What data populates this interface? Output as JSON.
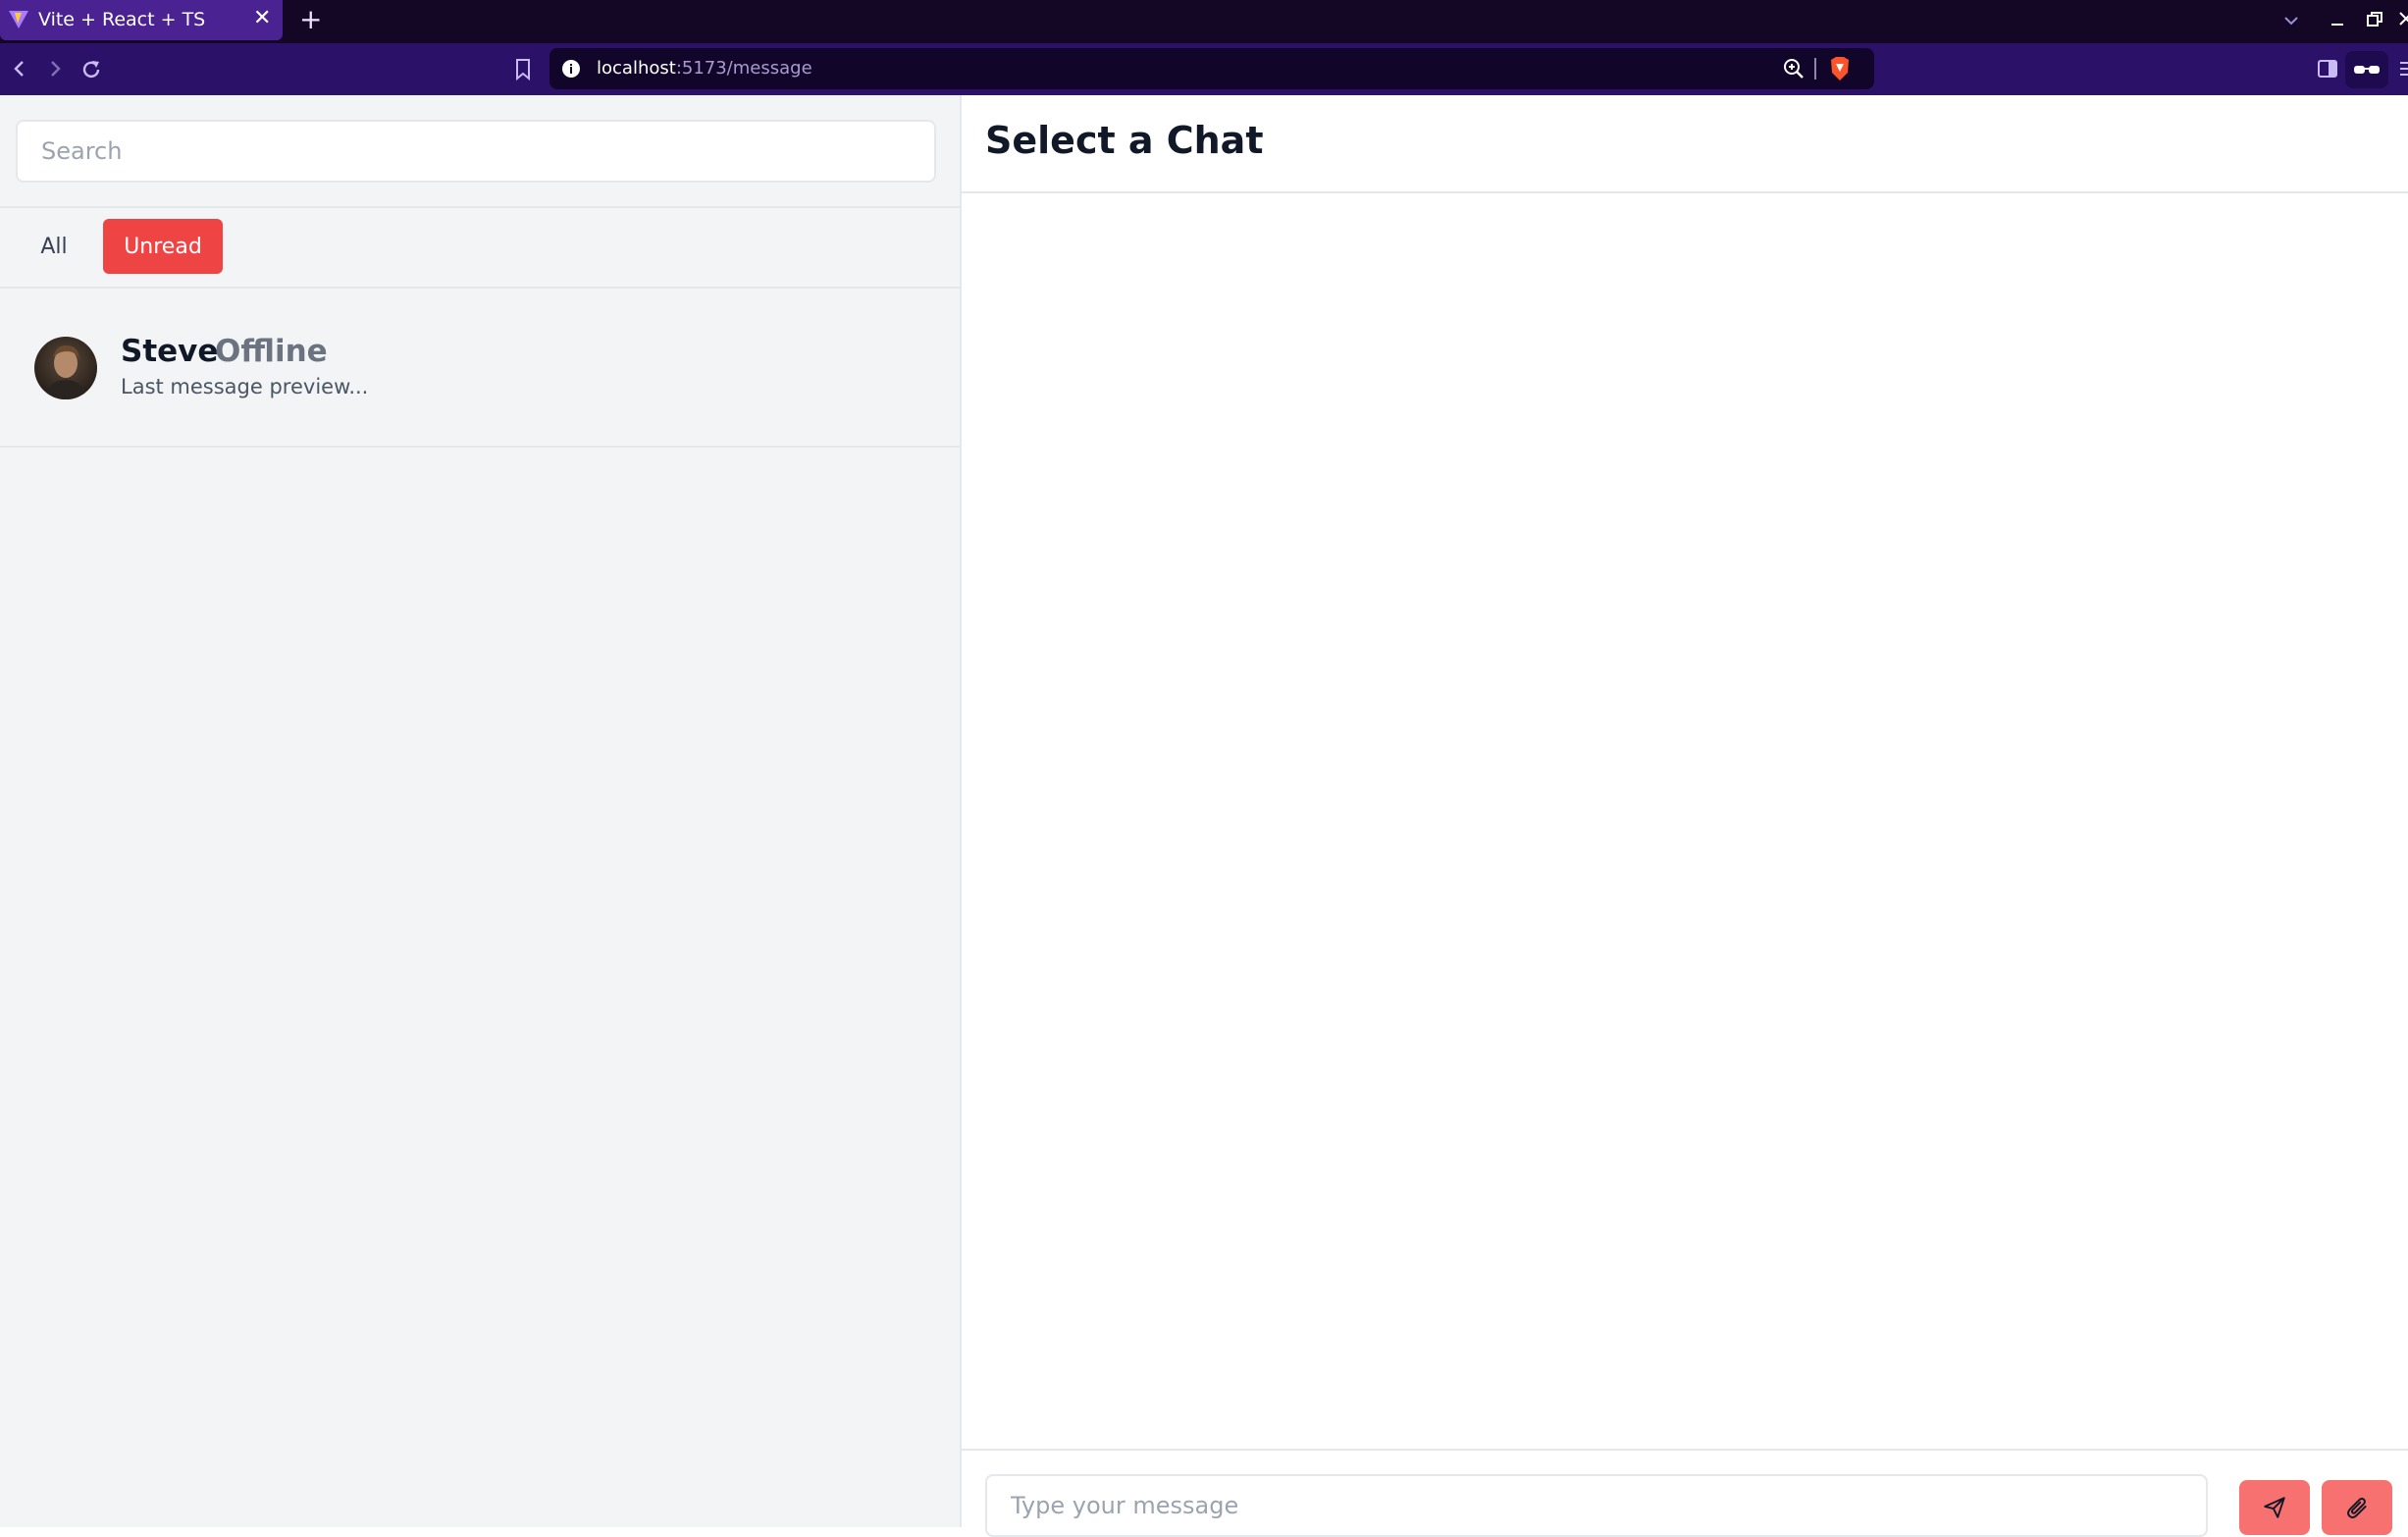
{
  "browser": {
    "tab_title": "Vite + React + TS",
    "tab_close": "✕",
    "new_tab": "+",
    "url_host": "localhost",
    "url_path": ":5173/message"
  },
  "sidebar": {
    "search_placeholder": "Search",
    "filters": {
      "all": "All",
      "unread": "Unread"
    },
    "chats": [
      {
        "name": "Steve",
        "status": "Offline",
        "preview": "Last message preview..."
      }
    ]
  },
  "chat": {
    "title": "Select a Chat",
    "input_placeholder": "Type your message"
  },
  "icons": {
    "send": "send-icon",
    "attach": "paperclip-icon",
    "avatar": "avatar-photo"
  },
  "colors": {
    "accent": "#ef4444",
    "accent_soft": "#f87171",
    "tabbar": "#140726",
    "toolbar": "#2c1169",
    "active_tab": "#4a2291"
  }
}
